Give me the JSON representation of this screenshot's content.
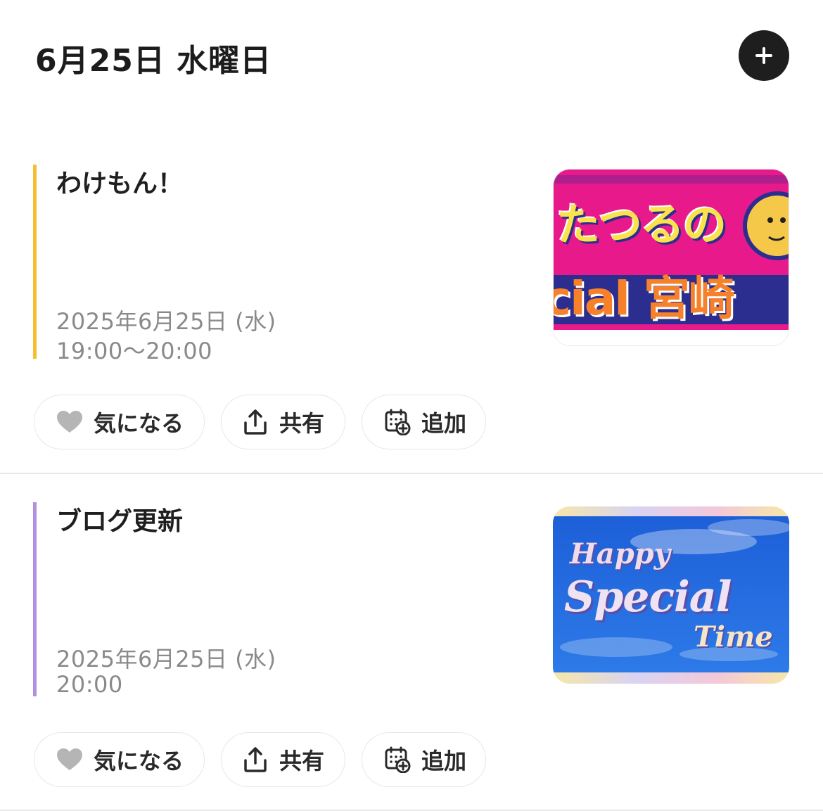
{
  "header": {
    "date_title": "6月25日 水曜日"
  },
  "events": [
    {
      "title": "わけもん！",
      "date": "2025年6月25日 (水)",
      "time": "19:00～20:00",
      "accent_color": "#f4bf35",
      "thumbnail_text": {
        "line1": "たつるの",
        "line2": "cial 宮崎"
      },
      "actions": {
        "favorite_label": "気になる",
        "share_label": "共有",
        "add_label": "追加"
      }
    },
    {
      "title": "ブログ更新",
      "date": "2025年6月25日 (水)",
      "time": "20:00",
      "accent_color": "#b38fe0",
      "thumbnail_text": {
        "line1": "Happy",
        "line2": "Special",
        "line3": "Time"
      },
      "actions": {
        "favorite_label": "気になる",
        "share_label": "共有",
        "add_label": "追加"
      }
    }
  ],
  "icons": {
    "add": "plus-icon",
    "favorite": "heart-icon",
    "share": "share-icon",
    "calendar_add": "calendar-add-icon"
  }
}
